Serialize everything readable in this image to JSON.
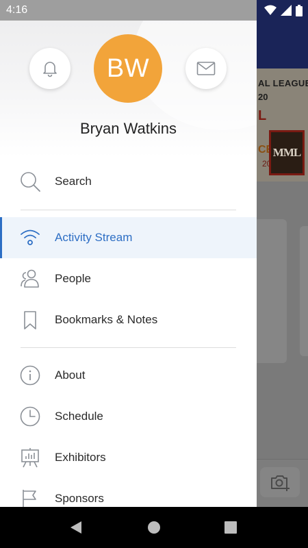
{
  "status_bar": {
    "time": "4:16"
  },
  "background_app": {
    "banner_line1": "AL LEAGUE",
    "banner_line2": "20",
    "banner_line3": "L",
    "banner_line4": "CE",
    "banner_line5": "20",
    "logo_text": "MML"
  },
  "drawer": {
    "avatar_initials": "BW",
    "user_name": "Bryan Watkins",
    "items": [
      {
        "label": "Search",
        "icon": "search-icon"
      },
      {
        "label": "Activity Stream",
        "icon": "wifi-icon",
        "active": true
      },
      {
        "label": "People",
        "icon": "people-icon"
      },
      {
        "label": "Bookmarks & Notes",
        "icon": "bookmark-icon"
      },
      {
        "label": "About",
        "icon": "info-icon"
      },
      {
        "label": "Schedule",
        "icon": "clock-icon"
      },
      {
        "label": "Exhibitors",
        "icon": "presentation-icon"
      },
      {
        "label": "Sponsors",
        "icon": "flag-icon"
      }
    ]
  },
  "colors": {
    "accent": "#2d6ec4",
    "avatar": "#f2a43a",
    "header_bar": "#1a2458"
  }
}
